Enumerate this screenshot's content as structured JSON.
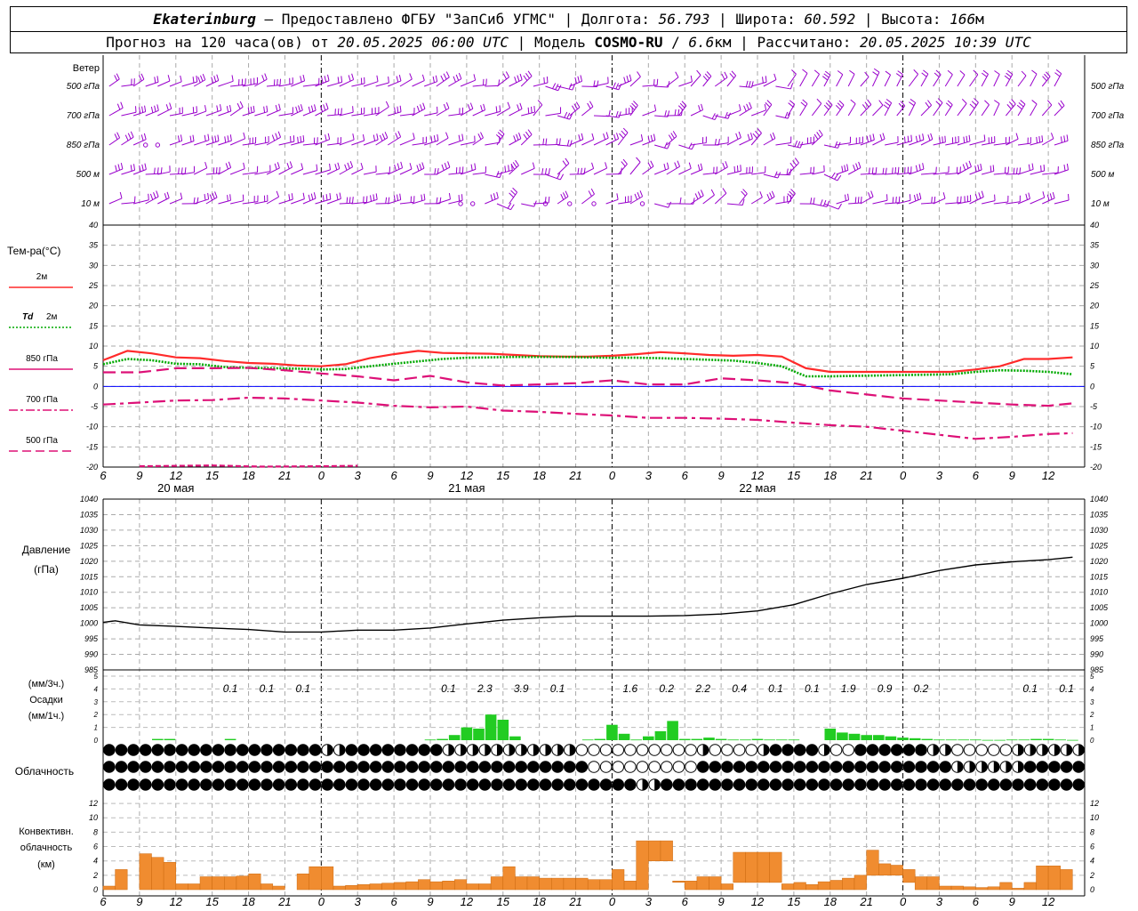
{
  "header": {
    "station": "Ekaterinburg",
    "provider": "— Предоставлено ФГБУ \"ЗапСиб УГМС\"",
    "lon_label": "Долгота:",
    "lon": "56.793",
    "lat_label": "Широта:",
    "lat": "60.592",
    "alt_label": "Высота:",
    "alt": "166",
    "alt_unit": "м",
    "forecast_label": "Прогноз на 120 часа(ов) от",
    "forecast_start": "20.05.2025 06:00 UTC",
    "model_label": "Модель",
    "model": "COSMO-RU",
    "resolution": "6.6",
    "res_unit": "км",
    "calc_label": "Рассчитано:",
    "calc_time": "20.05.2025 10:39 UTC"
  },
  "wind_panel": {
    "title": "Ветер",
    "levels": [
      "500 гПа",
      "700 гПа",
      "850 гПа",
      "500 м",
      "10 м"
    ]
  },
  "temp_panel": {
    "title": "Тем-ра(°C)",
    "legend": [
      {
        "label": "2м",
        "color": "#ff2a2a",
        "style": "solid"
      },
      {
        "label_prefix": "Td",
        "label": "2м",
        "color": "#00aa00",
        "style": "dotted"
      },
      {
        "label": "850 гПа",
        "color": "#dd1077",
        "style": "solid"
      },
      {
        "label": "700 гПа",
        "color": "#dd1077",
        "style": "dashdot"
      },
      {
        "label": "500 гПа",
        "color": "#dd1077",
        "style": "dashed"
      }
    ],
    "y_ticks": [
      40,
      35,
      30,
      25,
      20,
      15,
      10,
      5,
      0,
      -5,
      -10,
      -15,
      -20
    ]
  },
  "time_axis": {
    "hour_labels": [
      "6",
      "9",
      "12",
      "15",
      "18",
      "21",
      "0",
      "3",
      "6",
      "9",
      "12",
      "15",
      "18",
      "21",
      "0",
      "3",
      "6",
      "9",
      "12",
      "15",
      "18",
      "21",
      "0",
      "3",
      "6",
      "9",
      "12"
    ],
    "day_labels": [
      "20 мая",
      "21 мая",
      "22 мая"
    ]
  },
  "pressure_panel": {
    "title": "Давление",
    "unit": "(гПа)",
    "y_ticks": [
      1040,
      1035,
      1030,
      1025,
      1020,
      1015,
      1010,
      1005,
      1000,
      995,
      990,
      985
    ]
  },
  "precip_panel": {
    "unit_3h": "(мм/3ч.)",
    "title": "Осадки",
    "unit_1h": "(мм/1ч.)",
    "y_ticks": [
      5,
      4,
      3,
      2,
      1,
      0
    ],
    "totals_3h": [
      {
        "h": 10.5,
        "v": "0.1"
      },
      {
        "h": 13.5,
        "v": "0.1"
      },
      {
        "h": 16.5,
        "v": "0.1"
      },
      {
        "h": 28.5,
        "v": "0.1"
      },
      {
        "h": 31.5,
        "v": "2.3"
      },
      {
        "h": 34.5,
        "v": "3.9"
      },
      {
        "h": 37.5,
        "v": "0.1"
      },
      {
        "h": 43.5,
        "v": "1.6"
      },
      {
        "h": 46.5,
        "v": "0.2"
      },
      {
        "h": 49.5,
        "v": "2.2"
      },
      {
        "h": 52.5,
        "v": "0.4"
      },
      {
        "h": 55.5,
        "v": "0.1"
      },
      {
        "h": 58.5,
        "v": "0.1"
      },
      {
        "h": 61.5,
        "v": "1.9"
      },
      {
        "h": 64.5,
        "v": "0.9"
      },
      {
        "h": 67.5,
        "v": "0.2"
      },
      {
        "h": 76.5,
        "v": "0.1"
      },
      {
        "h": 79.5,
        "v": "0.1"
      }
    ]
  },
  "cloud_panel": {
    "title": "Облачность"
  },
  "conv_panel": {
    "title_1": "Конвективн.",
    "title_2": "облачность",
    "unit": "(км)",
    "y_ticks": [
      12,
      10,
      8,
      6,
      4,
      2,
      0
    ]
  },
  "colors": {
    "wind": "#9900cc",
    "t2m": "#ff2a2a",
    "td2m": "#00aa00",
    "t_upper": "#dd1077",
    "zero_line": "#0000ff",
    "precip": "#22cc22",
    "convective": "#f08c30",
    "grid": "#999999"
  },
  "chart_data": [
    {
      "type": "line",
      "title": "Тем-ра(°C)",
      "x_unit": "часы от 20.05.2025 06:00 UTC",
      "ylim": [
        -20,
        40
      ],
      "series": [
        {
          "name": "2м",
          "x": [
            0,
            2,
            4,
            6,
            8,
            10,
            12,
            14,
            16,
            18,
            20,
            22,
            24,
            26,
            28,
            30,
            32,
            34,
            36,
            38,
            40,
            42,
            44,
            46,
            48,
            50,
            52,
            54,
            56,
            58,
            60,
            62,
            64,
            66,
            68,
            70,
            72,
            74,
            76,
            78,
            80
          ],
          "values": [
            6.5,
            8.8,
            8.2,
            7.2,
            7.0,
            6.3,
            5.8,
            5.6,
            5.2,
            5.0,
            5.5,
            7.0,
            8.0,
            8.8,
            8.3,
            8.2,
            8.1,
            7.8,
            7.5,
            7.4,
            7.4,
            7.6,
            8.0,
            8.5,
            8.2,
            7.8,
            7.6,
            7.8,
            7.4,
            4.5,
            3.6,
            3.6,
            3.6,
            3.6,
            3.6,
            3.6,
            4.2,
            5.0,
            6.8,
            6.8,
            7.2
          ]
        },
        {
          "name": "Td 2м",
          "x": [
            0,
            2,
            4,
            6,
            8,
            10,
            12,
            14,
            16,
            18,
            20,
            22,
            24,
            26,
            28,
            30,
            32,
            34,
            36,
            38,
            40,
            42,
            44,
            46,
            48,
            50,
            52,
            54,
            56,
            58,
            60,
            62,
            64,
            66,
            68,
            70,
            72,
            74,
            76,
            78,
            80
          ],
          "values": [
            5.5,
            6.8,
            6.5,
            5.6,
            5.5,
            4.8,
            4.6,
            4.5,
            4.4,
            4.2,
            4.3,
            5.0,
            5.6,
            6.2,
            6.8,
            7.1,
            7.2,
            7.3,
            7.3,
            7.3,
            7.2,
            7.1,
            7.1,
            7.0,
            6.8,
            6.6,
            6.4,
            5.8,
            5.0,
            2.5,
            2.5,
            2.6,
            2.7,
            2.8,
            2.9,
            3.0,
            3.6,
            4.0,
            3.9,
            3.6,
            3.0
          ]
        },
        {
          "name": "850 гПа",
          "x": [
            0,
            3,
            6,
            9,
            12,
            15,
            18,
            21,
            24,
            27,
            30,
            33,
            36,
            39,
            42,
            45,
            48,
            51,
            54,
            57,
            60,
            63,
            66,
            69,
            72,
            75,
            78,
            80
          ],
          "values": [
            3.5,
            3.5,
            4.5,
            4.5,
            4.6,
            4.0,
            3.2,
            2.5,
            1.5,
            2.6,
            1.0,
            0.2,
            0.5,
            0.8,
            1.5,
            0.5,
            0.5,
            2.0,
            1.5,
            0.8,
            -1.0,
            -2.0,
            -3.0,
            -3.5,
            -4.0,
            -4.5,
            -4.8,
            -4.2
          ]
        },
        {
          "name": "700 гПа",
          "x": [
            0,
            3,
            6,
            9,
            12,
            15,
            18,
            21,
            24,
            27,
            30,
            33,
            36,
            39,
            42,
            45,
            48,
            51,
            54,
            57,
            60,
            63,
            66,
            69,
            72,
            75,
            78,
            80
          ],
          "values": [
            -4.5,
            -4.0,
            -3.5,
            -3.4,
            -2.8,
            -3.0,
            -3.5,
            -4.0,
            -4.8,
            -5.2,
            -5.0,
            -6.0,
            -6.3,
            -6.8,
            -7.2,
            -7.8,
            -7.8,
            -8.0,
            -8.3,
            -9.0,
            -9.6,
            -10.0,
            -11.0,
            -12.0,
            -13.0,
            -12.5,
            -11.8,
            -11.6
          ]
        },
        {
          "name": "500 гПа",
          "x": [
            3,
            9,
            13,
            18,
            21
          ],
          "values": [
            -19.8,
            -19.6,
            -19.9,
            -19.8,
            -19.7
          ]
        }
      ]
    },
    {
      "type": "line",
      "title": "Давление",
      "ylim": [
        985,
        1040
      ],
      "series": [
        {
          "name": "Давление",
          "x": [
            0,
            1,
            3,
            6,
            9,
            12,
            15,
            18,
            21,
            24,
            27,
            30,
            33,
            36,
            39,
            42,
            45,
            48,
            51,
            54,
            57,
            60,
            63,
            66,
            69,
            72,
            75,
            78,
            80
          ],
          "values": [
            1000.3,
            1000.8,
            999.5,
            999.0,
            998.5,
            998.0,
            997.2,
            997.2,
            997.8,
            997.8,
            998.5,
            999.8,
            1001,
            1001.8,
            1002.3,
            1002.3,
            1002.3,
            1002.5,
            1003,
            1004,
            1006,
            1009.5,
            1012.5,
            1014.5,
            1017,
            1018.8,
            1019.8,
            1020.5,
            1021.3
          ]
        }
      ]
    },
    {
      "type": "bar",
      "title": "Осадки",
      "ylim": [
        0,
        5
      ],
      "series": [
        {
          "name": "мм/1ч",
          "x": [
            4.5,
            5.5,
            10.5,
            27,
            28,
            29,
            30,
            31,
            32,
            33,
            34,
            40,
            41,
            42,
            43,
            44,
            45,
            46,
            47,
            48,
            49,
            50,
            51,
            52,
            53,
            54,
            55,
            56,
            57,
            60,
            61,
            62,
            63,
            64,
            65,
            66,
            67,
            68,
            69,
            70,
            71,
            72,
            73,
            74,
            75,
            76,
            77,
            78,
            79,
            80
          ],
          "values": [
            0.1,
            0.1,
            0.1,
            0.05,
            0.1,
            0.4,
            1.0,
            0.9,
            2.0,
            1.6,
            0.3,
            0.05,
            0.1,
            1.2,
            0.5,
            0.05,
            0.3,
            0.7,
            1.5,
            0.1,
            0.1,
            0.2,
            0.1,
            0.05,
            0.05,
            0.1,
            0.05,
            0.05,
            0.05,
            0.9,
            0.6,
            0.5,
            0.4,
            0.4,
            0.3,
            0.2,
            0.15,
            0.1,
            0.05,
            0.05,
            0.05,
            0.05,
            0.02,
            0.02,
            0.05,
            0.05,
            0.1,
            0.1,
            0.05,
            0.02
          ]
        }
      ]
    },
    {
      "type": "bar",
      "title": "Конвективн. облачность",
      "ylim": [
        0,
        13
      ],
      "series": [
        {
          "name": "base",
          "x": [
            0.5,
            1.5,
            3.5,
            4.5,
            5.5,
            6.5,
            7.5,
            8.5,
            9.5,
            10.5,
            11.5,
            12.5,
            13.5,
            14.5,
            16.5,
            17.5,
            18.5,
            19.5,
            20.5,
            21.5,
            22.5,
            23.5,
            24.5,
            25.5,
            26.5,
            27.5,
            28.5,
            29.5,
            30.5,
            31.5,
            32.5,
            33.5,
            34.5,
            35.5,
            36.5,
            37.5,
            38.5,
            39.5,
            40.5,
            41.5,
            42.5,
            43.5,
            44.5,
            45.5,
            46.5,
            47.5,
            48.5,
            49.5,
            50.5,
            51.5,
            52.5,
            53.5,
            54.5,
            55.5,
            56.5,
            57.5,
            58.5,
            59.5,
            60.5,
            61.5,
            62.5,
            63.5,
            64.5,
            65.5,
            66.5,
            67.5,
            68.5,
            69.5,
            70.5,
            71.5,
            72.5,
            73.5,
            74.5,
            75.5,
            76.5,
            77.5,
            78.5,
            79.5
          ],
          "values": [
            0,
            0,
            0,
            0,
            0,
            0,
            0,
            0,
            0,
            0,
            0,
            0,
            0,
            0,
            0,
            0,
            0,
            0,
            0,
            0,
            0,
            0,
            0,
            0,
            0,
            0,
            0,
            0,
            0,
            0,
            0,
            0,
            0,
            0,
            0,
            0,
            0,
            0,
            0,
            0,
            0,
            0,
            0,
            4,
            4,
            4,
            0,
            0,
            0,
            0,
            1,
            1,
            1,
            1,
            0,
            0,
            0,
            0,
            0,
            0,
            0,
            2,
            2,
            2,
            1,
            0,
            0,
            0,
            0,
            0,
            0,
            0,
            0,
            0,
            0,
            0,
            0,
            0
          ]
        },
        {
          "name": "top",
          "x": [
            0.5,
            1.5,
            3.5,
            4.5,
            5.5,
            6.5,
            7.5,
            8.5,
            9.5,
            10.5,
            11.5,
            12.5,
            13.5,
            14.5,
            16.5,
            17.5,
            18.5,
            19.5,
            20.5,
            21.5,
            22.5,
            23.5,
            24.5,
            25.5,
            26.5,
            27.5,
            28.5,
            29.5,
            30.5,
            31.5,
            32.5,
            33.5,
            34.5,
            35.5,
            36.5,
            37.5,
            38.5,
            39.5,
            40.5,
            41.5,
            42.5,
            43.5,
            44.5,
            45.5,
            46.5,
            47.5,
            48.5,
            49.5,
            50.5,
            51.5,
            52.5,
            53.5,
            54.5,
            55.5,
            56.5,
            57.5,
            58.5,
            59.5,
            60.5,
            61.5,
            62.5,
            63.5,
            64.5,
            65.5,
            66.5,
            67.5,
            68.5,
            69.5,
            70.5,
            71.5,
            72.5,
            73.5,
            74.5,
            75.5,
            76.5,
            77.5,
            78.5,
            79.5
          ],
          "values": [
            0.5,
            2.8,
            5,
            4.5,
            3.8,
            0.8,
            0.8,
            1.8,
            1.8,
            1.8,
            1.9,
            2.2,
            0.8,
            0.5,
            2.2,
            3.2,
            3.2,
            0.5,
            0.6,
            0.7,
            0.8,
            0.9,
            1.0,
            1.1,
            1.4,
            1.1,
            1.2,
            1.4,
            0.8,
            0.8,
            1.8,
            3.2,
            1.8,
            1.8,
            1.6,
            1.6,
            1.6,
            1.6,
            1.4,
            1.4,
            2.8,
            1.2,
            6.8,
            6.8,
            6.8,
            1.2,
            1.2,
            1.8,
            1.8,
            0.8,
            5.2,
            5.2,
            5.2,
            5.2,
            0.8,
            1.0,
            0.7,
            1.1,
            1.3,
            1.6,
            2.0,
            5.5,
            3.6,
            3.4,
            2.8,
            1.8,
            1.8,
            0.5,
            0.5,
            0.4,
            0.3,
            0.4,
            1.0,
            0.2,
            1.0,
            3.3,
            3.3,
            2.8
          ]
        }
      ]
    }
  ]
}
